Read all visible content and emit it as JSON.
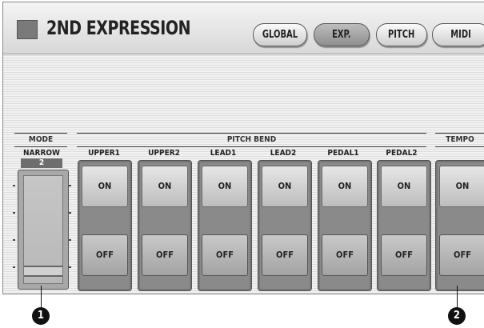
{
  "header": {
    "title": "2ND EXPRESSION",
    "tabs": [
      {
        "label": "GLOBAL",
        "active": false
      },
      {
        "label": "EXP.",
        "active": true
      },
      {
        "label": "PITCH",
        "active": false
      },
      {
        "label": "MIDI",
        "active": false
      }
    ]
  },
  "groups": {
    "mode": "MODE",
    "pitch_bend": "PITCH BEND",
    "tempo": "TEMPO"
  },
  "mode": {
    "label": "NARROW",
    "value": "2"
  },
  "columns": [
    {
      "label": "UPPER1",
      "on": "ON",
      "off": "OFF"
    },
    {
      "label": "UPPER2",
      "on": "ON",
      "off": "OFF"
    },
    {
      "label": "LEAD1",
      "on": "ON",
      "off": "OFF"
    },
    {
      "label": "LEAD2",
      "on": "ON",
      "off": "OFF"
    },
    {
      "label": "PEDAL1",
      "on": "ON",
      "off": "OFF"
    },
    {
      "label": "PEDAL2",
      "on": "ON",
      "off": "OFF"
    }
  ],
  "tempo": {
    "on": "ON",
    "off": "OFF"
  },
  "callouts": [
    "1",
    "2"
  ]
}
